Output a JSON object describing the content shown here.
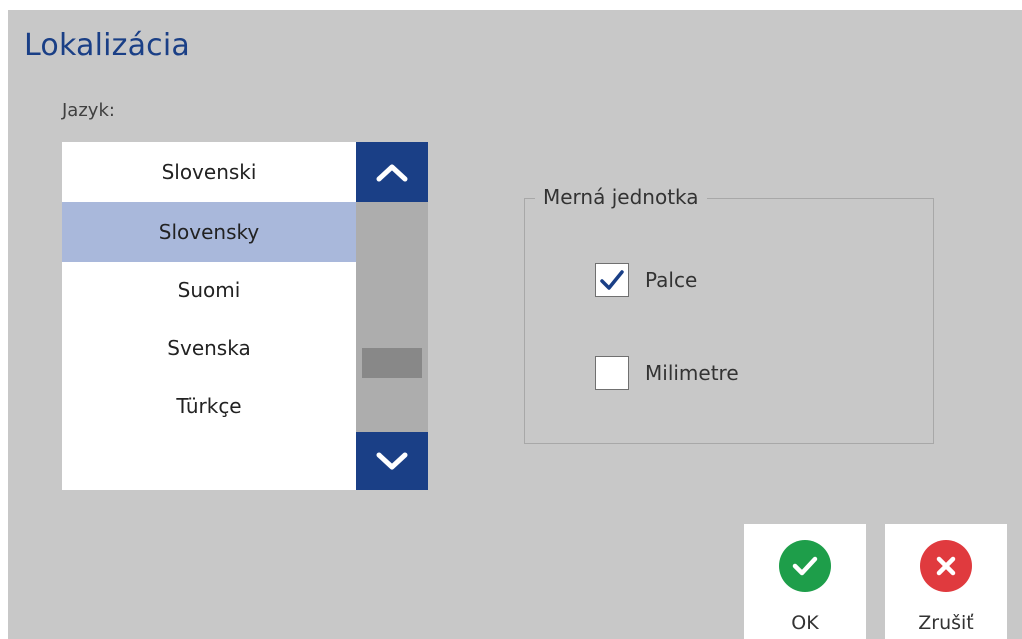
{
  "dialog": {
    "title": "Lokalizácia"
  },
  "language": {
    "label": "Jazyk:",
    "items": [
      {
        "label": "Slovenski",
        "selected": false
      },
      {
        "label": "Slovensky",
        "selected": true
      },
      {
        "label": "Suomi",
        "selected": false
      },
      {
        "label": "Svenska",
        "selected": false
      },
      {
        "label": "Türkçe",
        "selected": false
      }
    ],
    "scroll_up_icon": "chevron-up-icon",
    "scroll_down_icon": "chevron-down-icon"
  },
  "units": {
    "legend": "Merná jednotka",
    "options": [
      {
        "label": "Palce",
        "checked": true
      },
      {
        "label": "Milimetre",
        "checked": false
      }
    ]
  },
  "actions": {
    "ok": {
      "label": "OK",
      "icon": "check-circle-icon",
      "color": "#1e9e4a"
    },
    "cancel": {
      "label": "Zrušiť",
      "icon": "x-circle-icon",
      "color": "#e03a3e"
    }
  },
  "colors": {
    "accent": "#1a3f86",
    "selection": "#a9b8db",
    "dialog_bg": "#c8c8c8"
  }
}
